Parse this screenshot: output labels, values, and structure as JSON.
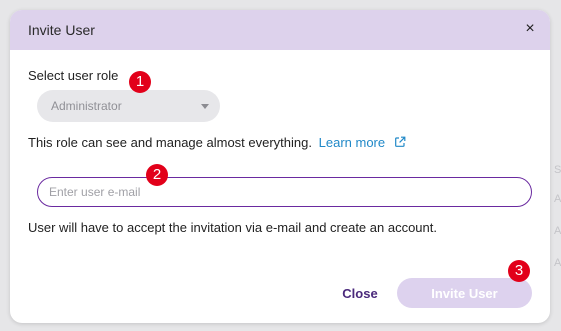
{
  "dialog": {
    "title": "Invite User",
    "close_icon_glyph": "×"
  },
  "role": {
    "label": "Select user role",
    "selected": "Administrator",
    "description": "This role can see and manage almost everything.",
    "learn_more": "Learn more"
  },
  "email": {
    "value": "",
    "placeholder": "Enter user e-mail"
  },
  "note": "User will have to accept the invitation via e-mail and create an account.",
  "actions": {
    "close_label": "Close",
    "invite_label": "Invite User"
  },
  "markers": [
    "1",
    "2",
    "3"
  ],
  "background_letters": [
    "S",
    "A",
    "A",
    "A"
  ],
  "colors": {
    "header_bg": "#ddd2ec",
    "accent": "#6a2aa0",
    "link": "#2189c8",
    "badge": "#e2001a",
    "invite_disabled_bg": "#ddd2ee"
  }
}
